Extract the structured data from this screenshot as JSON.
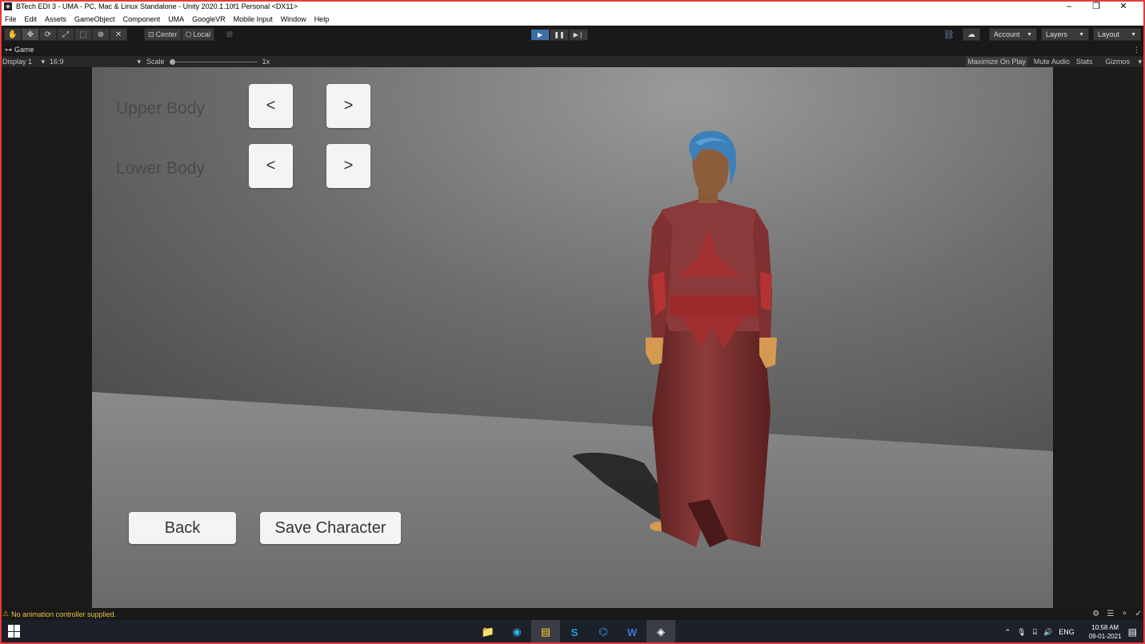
{
  "window": {
    "title": "BTech EDI 3 - UMA - PC, Mac & Linux Standalone - Unity 2020.1.10f1 Personal <DX11>",
    "controls": {
      "minimize": "–",
      "restore": "❐",
      "close": "✕"
    }
  },
  "menubar": [
    "File",
    "Edit",
    "Assets",
    "GameObject",
    "Component",
    "UMA",
    "GoogleVR",
    "Mobile Input",
    "Window",
    "Help"
  ],
  "toolbar": {
    "tools": [
      {
        "icon": "hand-icon",
        "glyph": "✋"
      },
      {
        "icon": "move-icon",
        "glyph": "✥"
      },
      {
        "icon": "rotate-icon",
        "glyph": "⟳"
      },
      {
        "icon": "scale-icon",
        "glyph": "⤢"
      },
      {
        "icon": "rect-icon",
        "glyph": "⬚"
      },
      {
        "icon": "transform-icon",
        "glyph": "⊕"
      },
      {
        "icon": "custom-tool-icon",
        "glyph": "✕"
      }
    ],
    "pivot": "Center",
    "space": "Local",
    "account": "Account",
    "layers": "Layers",
    "layout": "Layout"
  },
  "tab": {
    "name": "Game",
    "menu": "⋮"
  },
  "gamebar": {
    "display": "Display 1",
    "aspect": "16:9",
    "scale_label": "Scale",
    "scale_value": "1x",
    "scale_level": 0,
    "maximize": "Maximize On Play",
    "mute": "Mute Audio",
    "stats": "Stats",
    "gizmos": "Gizmos"
  },
  "game_ui": {
    "upper_body": "Upper Body",
    "lower_body": "Lower Body",
    "prev": "<",
    "next": ">",
    "back": "Back",
    "save": "Save Character"
  },
  "status": {
    "message": "No animation controller supplied."
  },
  "taskbar": {
    "apps": [
      {
        "name": "file-explorer",
        "glyph": "📁"
      },
      {
        "name": "edge",
        "glyph": "◉"
      },
      {
        "name": "sticky-notes",
        "glyph": "▤"
      },
      {
        "name": "skype",
        "glyph": "S"
      },
      {
        "name": "vscode",
        "glyph": "⌬"
      },
      {
        "name": "word",
        "glyph": "W"
      },
      {
        "name": "unity",
        "glyph": "◈"
      }
    ],
    "lang": "ENG",
    "time": "10:58 AM",
    "date": "09-01-2021"
  }
}
